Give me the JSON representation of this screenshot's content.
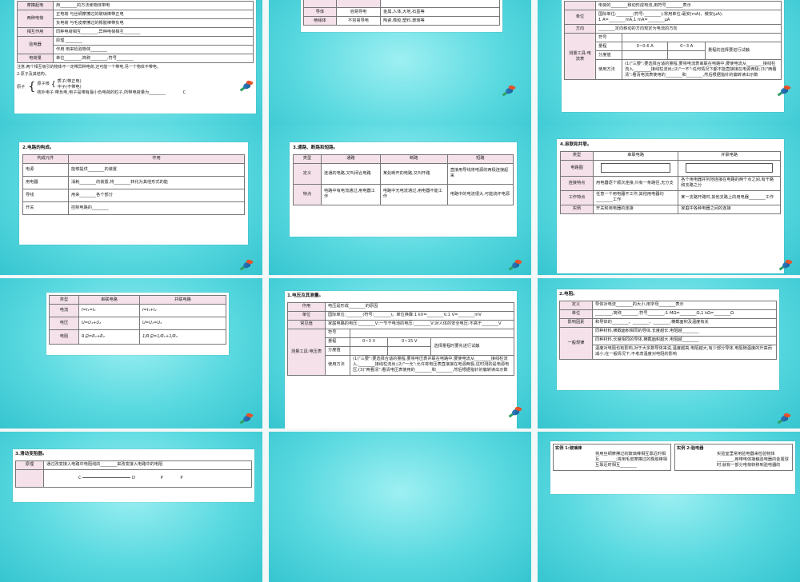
{
  "slide1": {
    "rows": [
      {
        "k": "摩擦起电",
        "v": "用________的方法使物体带电"
      },
      {
        "k": "两种电荷",
        "v": "正电荷  与丝绸摩擦过的玻璃棒带正电"
      },
      {
        "k": "",
        "v": "负电荷  与毛皮摩擦过的橡胶棒带负电"
      },
      {
        "k": "相互作用",
        "v": "同种电荷相互________,异种电荷相互________"
      },
      {
        "k": "验电器",
        "v": "原理  ________"
      },
      {
        "k": "",
        "v": "作用  用来检验物体________"
      },
      {
        "k": "电荷量",
        "v": "单位________,简称________,符号________"
      }
    ],
    "note": "注意:两个相互吸引的物体不一定带异种电荷,还可能一个带电,另一个物体不带电。",
    "atom_title": "2.原子及其结构。",
    "atom_label": "原子",
    "atom_core": "原子核",
    "atom_p": "质子(带正电)",
    "atom_n": "中子(不带电)",
    "atom_e": "核外电子:带负电,电子是带有最小负电荷的粒子,所带电荷量为________",
    "atom_c": "C"
  },
  "slide2": {
    "rows": [
      {
        "a": "导体",
        "b": "容易导电",
        "c": "金属,人体,大地,石墨等"
      },
      {
        "a": "绝缘体",
        "b": "不容易导电",
        "c": "陶瓷,橡胶,塑料,玻璃等"
      }
    ]
  },
  "slide3": {
    "r0": "电荷的________移动形成电流,用符号________表示",
    "unit_k": "单位",
    "unit_v1": "国际单位:________(符号:________);常用单位:毫安(mA)、微安(μA);",
    "unit_v2": "1 A=________mA,1 mA=________μA",
    "dir_k": "方向",
    "dir_v": "________定向移动的方向规定为电流的方向",
    "tool_k": "测量工具:电流表",
    "sym": "符号",
    "range": "量程",
    "r1": "0~0.6 A",
    "r2": "0~3 A",
    "range_note": "量程的选择要进行试触",
    "div": "分度值",
    "use": "使用方法",
    "use_text": "(1)\"三要\":要选择合适的量程,要将电流表串联在电路中,要使电流从________接线柱流入,________接线柱流出;(2)\"一不\":任何情况下都不能直接接在电源两极;(3)\"两看清\":看清电流表使用的________和________,然后根据指针的偏转读出示数"
  },
  "slide4": {
    "title": "2.电路的构成。",
    "head": [
      "构成元件",
      "作用"
    ],
    "rows": [
      {
        "a": "电源",
        "b": "能够提供________的装置"
      },
      {
        "a": "用电器",
        "b": "消耗________的装置,将________转化为其他形式的能"
      },
      {
        "a": "导线",
        "b": "用来________各个部分"
      },
      {
        "a": "开关",
        "b": "控制电路的________"
      }
    ]
  },
  "slide5": {
    "title": "3.通路、断路和短路。",
    "head": [
      "类型",
      "通路",
      "断路",
      "短路"
    ],
    "def_k": "定义",
    "def": [
      "连通的电路,又叫闭合电路",
      "某处断开的电路,又叫开路",
      "直接用导线将电源的两极连接起来"
    ],
    "feat_k": "特点",
    "feat": [
      "电路中有电流通过,用电器工作",
      "电路中无电流通过,用电器不能工作",
      "电路中的电流很大,可能烧坏电源"
    ]
  },
  "slide6": {
    "title": "4.串联和并联。",
    "head": [
      "类型",
      "串联电路",
      "并联电路"
    ],
    "diagram_k": "电路图",
    "conn_k": "连接特点",
    "conn": [
      "用电器逐个顺次连接,只有一条路径,无分支",
      "各个用电器并列地连接在电路的两个点之间,有干路和支路之分"
    ],
    "work_k": "工作特点",
    "work": [
      "任意一个用电器不工作,其他用电器均________工作",
      "某一支路开路时,其他支路上的用电器________工作"
    ],
    "ex_k": "实例",
    "ex": [
      "开关和用电器的连接",
      "家庭中各种电器之间的连接"
    ]
  },
  "slide7": {
    "head": [
      "类型",
      "串联电路",
      "并联电路"
    ],
    "rows": [
      {
        "a": "电流",
        "b": "I=I₁=I₂",
        "c": "I=I₁+I₂"
      },
      {
        "a": "电压",
        "b": "U=U₁+U₂",
        "c": "U=U₁=U₂"
      },
      {
        "a": "电阻",
        "b": "R总=R₁+R₂",
        "c": "1/R总=1/R₁+1/R₂"
      }
    ]
  },
  "slide8": {
    "title": "1.电压及其测量。",
    "r0_k": "作用",
    "r0_v": "电压是形成________的原因",
    "unit_k": "单位",
    "unit_v": "国际单位:________(符号:________)。单位换算:1 kV=________V,1 V=________mV",
    "common_k": "常见值",
    "common_v1": "家庭电路的电压:________V;一节干电池的电压:________V;对人体的安全电压:不高于________V",
    "tool_k": "测量工具:电压表",
    "sym": "符号",
    "range": "量程",
    "r1": "0~3 V",
    "r2": "0~15 V",
    "range_note": "选择量程时要先进行试触",
    "div": "分度值",
    "use": "使用方法",
    "use_text": "(1)\"三要\":要选择合适的量程,要将电压表并联在电路中,要使电流从________接线柱流入,________接线柱流出;(2)\"一允\":允许将电压表直接接在电源两极,这时测的是电源电压;(3)\"两看清\":看清电压表使用的________和________,然后根据指针的偏转读出示数"
  },
  "slide9": {
    "title": "2.电阻。",
    "def_k": "定义",
    "def_v": "导体对电流________的大小,用字母________表示",
    "unit_k": "单位",
    "unit_v": "________,简称________,符号________;1 MΩ=________Ω,1 kΩ=________Ω",
    "fac_k": "影响因素",
    "fac_v": "和导体的________、________、________,横截面积及温度有关",
    "law_k": "一般规律",
    "law1": "同种材料,横截面积相同的导体,长度越长,电阻越________",
    "law2": "同种材料,长度相同的导体,横截面积越大,电阻越________",
    "law3": "温度对电阻也有影响,对于大多数导体来说,温度越高,电阻越大,有少部分导体,电阻随温度的升高而减小;在一般情况下,不考虑温度对电阻的影响"
  },
  "slide10": {
    "title": "3.滑动变阻器。",
    "k": "原理",
    "v": "通过改变接入电路中电阻线的________来改变接入电路中的电阻",
    "c": "C",
    "d": "D",
    "p": "P"
  },
  "slide12": {
    "ex1": "实例 1:玻璃棒",
    "ex1_text": "将用丝绸摩擦过的玻璃棒相互靠近时相互________;将用毛皮摩擦过的橡胶棒相互靠近时相互________",
    "ex2": "实例 2:验电器",
    "ex2_text": "实验室里常用验电器来检验物体________,用带电体接触验电器的金属球时,就有一部分电荷转移到验电器的"
  }
}
